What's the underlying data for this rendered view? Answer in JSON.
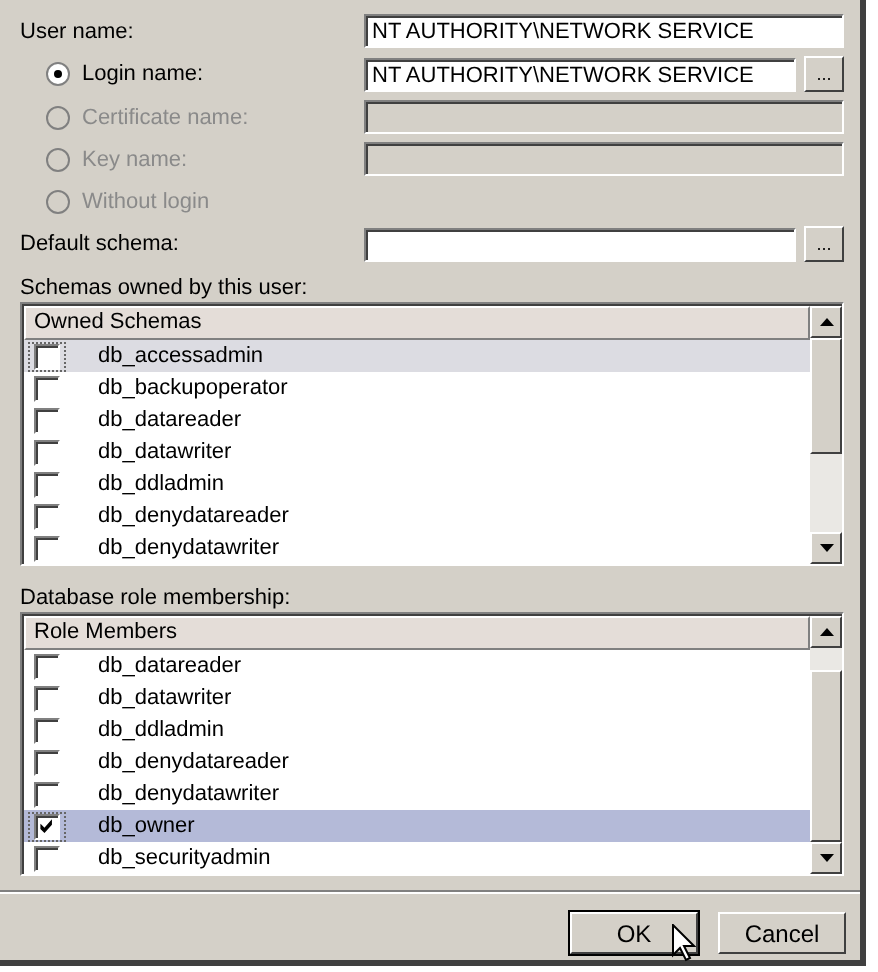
{
  "user_name": {
    "label": "User name:",
    "value": "NT AUTHORITY\\NETWORK SERVICE"
  },
  "login_options": [
    {
      "label": "Login name:",
      "selected": true,
      "disabled": false,
      "field": {
        "value": "NT AUTHORITY\\NETWORK SERVICE",
        "disabled": false
      },
      "browse": "..."
    },
    {
      "label": "Certificate name:",
      "selected": false,
      "disabled": true,
      "field": {
        "disabled": true
      }
    },
    {
      "label": "Key name:",
      "selected": false,
      "disabled": true,
      "field": {
        "disabled": true
      }
    },
    {
      "label": "Without login",
      "selected": false,
      "disabled": true
    }
  ],
  "default_schema": {
    "label": "Default schema:",
    "field": {
      "disabled": false
    },
    "browse": "..."
  },
  "owned_schemas": {
    "label": "Schemas owned by this user:",
    "header": "Owned Schemas",
    "focused": false,
    "items": [
      {
        "name": "db_accessadmin",
        "checked": false,
        "selected": true
      },
      {
        "name": "db_backupoperator",
        "checked": false,
        "selected": false
      },
      {
        "name": "db_datareader",
        "checked": false,
        "selected": false
      },
      {
        "name": "db_datawriter",
        "checked": false,
        "selected": false
      },
      {
        "name": "db_ddladmin",
        "checked": false,
        "selected": false
      },
      {
        "name": "db_denydatareader",
        "checked": false,
        "selected": false
      },
      {
        "name": "db_denydatawriter",
        "checked": false,
        "selected": false
      }
    ]
  },
  "role_membership": {
    "label": "Database role membership:",
    "header": "Role Members",
    "focused": true,
    "items": [
      {
        "name": "db_datareader",
        "checked": false,
        "selected": false
      },
      {
        "name": "db_datawriter",
        "checked": false,
        "selected": false
      },
      {
        "name": "db_ddladmin",
        "checked": false,
        "selected": false
      },
      {
        "name": "db_denydatareader",
        "checked": false,
        "selected": false
      },
      {
        "name": "db_denydatawriter",
        "checked": false,
        "selected": false
      },
      {
        "name": "db_owner",
        "checked": true,
        "selected": true
      },
      {
        "name": "db_securityadmin",
        "checked": false,
        "selected": false
      }
    ]
  },
  "buttons": [
    {
      "label": "OK",
      "default": true
    },
    {
      "label": "Cancel",
      "default": false
    }
  ]
}
